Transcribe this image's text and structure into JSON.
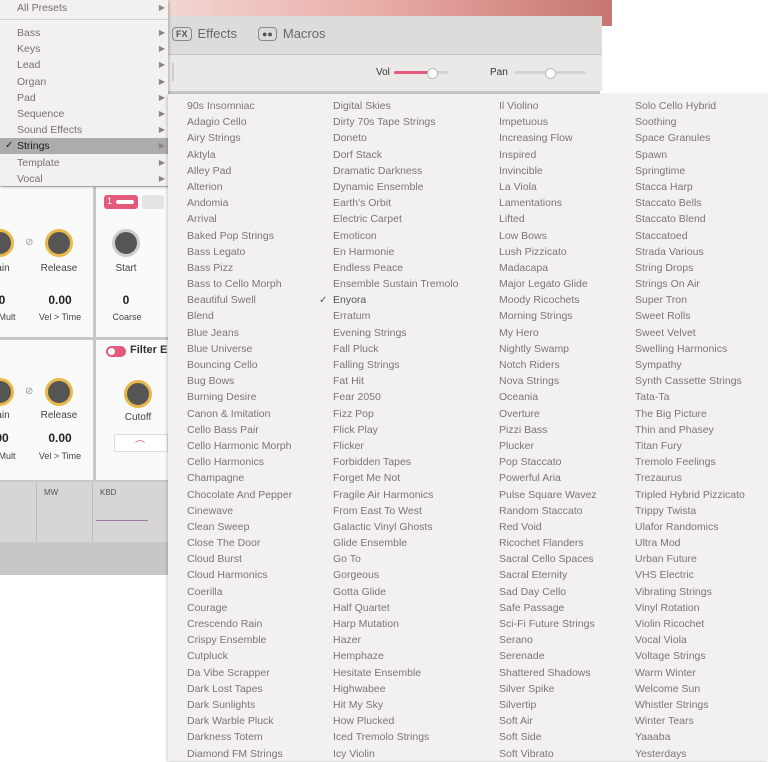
{
  "preset_menu": {
    "all_presets": "All Presets",
    "items": [
      "Bass",
      "Keys",
      "Lead",
      "Organ",
      "Pad",
      "Sequence",
      "Sound Effects",
      "Strings",
      "Template",
      "Vocal"
    ],
    "selected": "Strings"
  },
  "app": {
    "tabs": [
      {
        "badge": "FX",
        "label": "Effects"
      },
      {
        "badge": "●●",
        "label": "Macros"
      }
    ],
    "vol_label": "Vol",
    "pan_label": "Pan",
    "vol_level": 0.7,
    "pan_level": 0.5,
    "env1": {
      "knob_a": "ain",
      "knob_b": "Release",
      "val_a": "0",
      "val_b": "0.00",
      "sub_a": "Mult",
      "sub_b": "Vel > Time"
    },
    "env2": {
      "knob_a": "ain",
      "knob_b": "Release",
      "val_a": "00",
      "val_b": "0.00",
      "sub_a": "Mult",
      "sub_b": "Vel > Time"
    },
    "osc": {
      "knob": "Start",
      "value": "0",
      "sub": "Coarse",
      "tab_number": "1"
    },
    "filter": {
      "title": "Filter E",
      "knob": "Cutoff"
    },
    "mod_labels": [
      "MW",
      "KBD"
    ]
  },
  "strings_menu": {
    "checked": "Enyora",
    "columns": [
      [
        "90s Insomniac",
        "Adagio Cello",
        "Airy Strings",
        "Aktyla",
        "Alley Pad",
        "Alterion",
        "Andomia",
        "Arrival",
        "Baked Pop Strings",
        "Bass Legato",
        "Bass Pizz",
        "Bass to Cello Morph",
        "Beautiful Swell",
        "Blend",
        "Blue Jeans",
        "Blue Universe",
        "Bouncing Cello",
        "Bug Bows",
        "Burning Desire",
        "Canon & Imitation",
        "Cello Bass Pair",
        "Cello Harmonic Morph",
        "Cello Harmonics",
        "Champagne",
        "Chocolate And Pepper",
        "Cinewave",
        "Clean Sweep",
        "Close The Door",
        "Cloud Burst",
        "Cloud Harmonics",
        "Coerilla",
        "Courage",
        "Crescendo Rain",
        "Crispy Ensemble",
        "Cutpluck",
        "Da Vibe Scrapper",
        "Dark Lost Tapes",
        "Dark Sunlights",
        "Dark Warble Pluck",
        "Darkness Totem",
        "Diamond FM Strings"
      ],
      [
        "Digital Skies",
        "Dirty 70s Tape Strings",
        "Doneto",
        "Dorf Stack",
        "Dramatic Darkness",
        "Dynamic Ensemble",
        "Earth's Orbit",
        "Electric Carpet",
        "Emoticon",
        "En Harmonie",
        "Endless Peace",
        "Ensemble Sustain Tremolo",
        "Enyora",
        "Erratum",
        "Evening Strings",
        "Fall Pluck",
        "Falling Strings",
        "Fat Hit",
        "Fear 2050",
        "Fizz Pop",
        "Flick Play",
        "Flicker",
        "Forbidden Tapes",
        "Forget Me Not",
        "Fragile Air Harmonics",
        "From East To West",
        "Galactic Vinyl Ghosts",
        "Glide Ensemble",
        "Go To",
        "Gorgeous",
        "Gotta Glide",
        "Half Quartet",
        "Harp Mutation",
        "Hazer",
        "Hemphaze",
        "Hesitate Ensemble",
        "Highwabee",
        "Hit My Sky",
        "How Plucked",
        "Iced Tremolo Strings",
        "Icy Violin"
      ],
      [
        "Il Violino",
        "Impetuous",
        "Increasing Flow",
        "Inspired",
        "Invincible",
        "La Viola",
        "Lamentations",
        "Lifted",
        "Low Bows",
        "Lush Pizzicato",
        "Madacapa",
        "Major Legato Glide",
        "Moody Ricochets",
        "Morning Strings",
        "My Hero",
        "Nightly Swamp",
        "Notch Riders",
        "Nova Strings",
        "Oceania",
        "Overture",
        "Pizzi Bass",
        "Plucker",
        "Pop Staccato",
        "Powerful Aria",
        "Pulse Square Wavez",
        "Random Staccato",
        "Red Void",
        "Ricochet Flanders",
        "Sacral Cello Spaces",
        "Sacral Eternity",
        "Sad Day Cello",
        "Safe Passage",
        "Sci-Fi Future Strings",
        "Serano",
        "Serenade",
        "Shattered Shadows",
        "Silver Spike",
        "Silvertip",
        "Soft Air",
        "Soft Side",
        "Soft Vibrato"
      ],
      [
        "Solo Cello Hybrid",
        "Soothing",
        "Space Granules",
        "Spawn",
        "Springtime",
        "Stacca Harp",
        "Staccato Bells",
        "Staccato Blend",
        "Staccatoed",
        "Strada Various",
        "String Drops",
        "Strings On Air",
        "Super Tron",
        "Sweet Rolls",
        "Sweet Velvet",
        "Swelling Harmonics",
        "Sympathy",
        "Synth Cassette Strings",
        "Tata-Ta",
        "The Big Picture",
        "Thin and Phasey",
        "Titan Fury",
        "Tremolo Feelings",
        "Trezaurus",
        "Tripled Hybrid Pizzicato",
        "Trippy Twista",
        "Ulafor Randomics",
        "Ultra Mod",
        "Urban Future",
        "VHS Electric",
        "Vibrating Strings",
        "Vinyl Rotation",
        "Violin Ricochet",
        "Vocal Viola",
        "Voltage Strings",
        "Warm Winter",
        "Welcome Sun",
        "Whistler Strings",
        "Winter Tears",
        "Yaaaba",
        "Yesterdays"
      ]
    ]
  }
}
